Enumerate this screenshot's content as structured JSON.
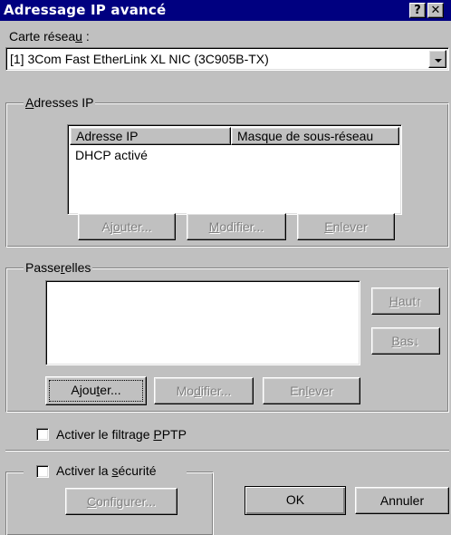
{
  "window": {
    "title": "Adressage IP avancé",
    "help_button": "?",
    "close_button": "✕"
  },
  "network_card": {
    "label_pre": "Carte résea",
    "label_accel": "u",
    "label_post": " :",
    "selected": "[1] 3Com Fast EtherLink XL NIC (3C905B-TX)"
  },
  "ip_addresses": {
    "group_accel": "A",
    "group_post": "dresses IP",
    "columns": [
      "Adresse IP",
      "Masque de sous-réseau"
    ],
    "rows": [
      {
        "ip": "DHCP activé",
        "mask": ""
      }
    ],
    "add_pre": "Aj",
    "add_accel": "o",
    "add_post": "uter...",
    "modify_accel": "M",
    "modify_post": "odifier...",
    "remove_accel": "E",
    "remove_post": "nlever"
  },
  "gateways": {
    "group_pre": "Passe",
    "group_accel": "r",
    "group_post": "elles",
    "up_accel": "H",
    "up_post": "aut↑",
    "down_accel": "B",
    "down_post": "as↓",
    "add_pre": "Ajou",
    "add_accel": "t",
    "add_post": "er...",
    "modify_pre": "Mo",
    "modify_accel": "d",
    "modify_post": "ifier...",
    "remove_pre": "En",
    "remove_accel": "l",
    "remove_post": "ever"
  },
  "pptp": {
    "label_pre": "Activer le filtrage ",
    "label_accel": "P",
    "label_post": "PTP",
    "checked": false
  },
  "security": {
    "label_pre": "Activer la ",
    "label_accel": "s",
    "label_post": "écurité",
    "checked": false,
    "configure_accel": "C",
    "configure_post": "onfigurer..."
  },
  "dialog_buttons": {
    "ok": "OK",
    "cancel": "Annuler"
  }
}
